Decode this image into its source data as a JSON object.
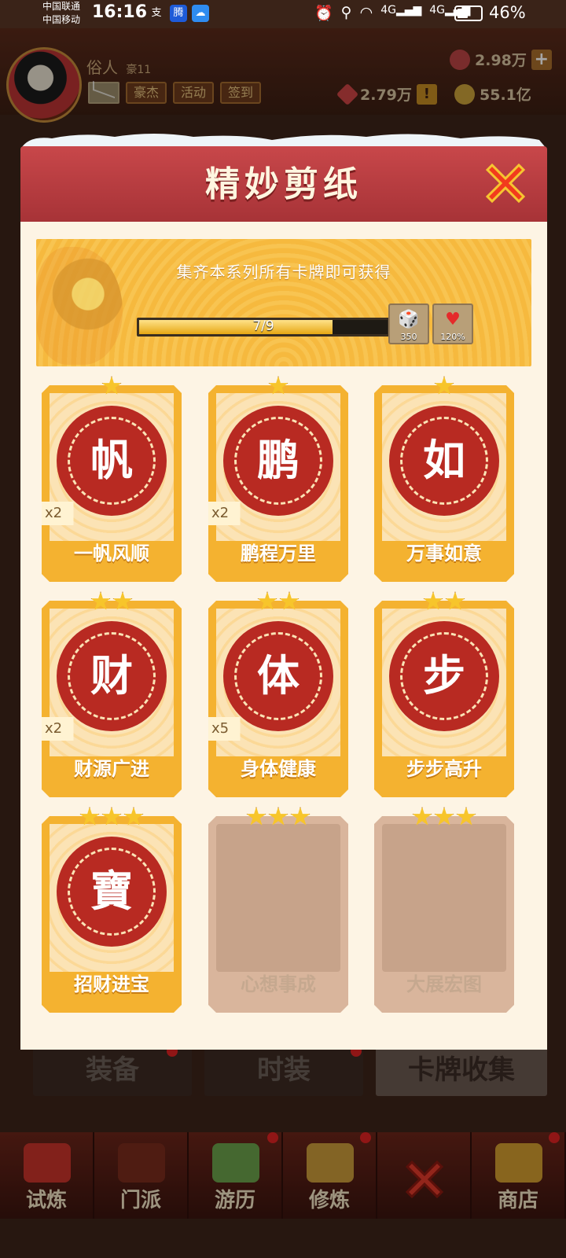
{
  "status_bar": {
    "carrier_1": "中国联通",
    "carrier_2": "中国移动",
    "time": "16:16",
    "battery_percent": "46%",
    "battery_level": 0.46
  },
  "player": {
    "name": "俗人",
    "rank": "豪11",
    "buttons": {
      "hero": "豪杰",
      "activity": "活动",
      "signin": "签到"
    }
  },
  "resources": {
    "gems": "2.98万",
    "diamonds": "2.79万",
    "coins": "55.1亿"
  },
  "modal": {
    "title": "精妙剪纸",
    "banner_text": "集齐本系列所有卡牌即可获得",
    "progress_text": "7/9",
    "progress_fraction": 0.778,
    "rewards": [
      {
        "icon": "dice-icon",
        "glyph": "🎲",
        "label": "350"
      },
      {
        "icon": "heart-icon",
        "glyph": "♥",
        "label": "120%"
      }
    ],
    "cards": [
      {
        "name": "一帆风顺",
        "stars": 1,
        "mult": "x2",
        "glyph": "帆",
        "locked": false
      },
      {
        "name": "鹏程万里",
        "stars": 1,
        "mult": "x2",
        "glyph": "鹏",
        "locked": false
      },
      {
        "name": "万事如意",
        "stars": 1,
        "mult": "",
        "glyph": "如",
        "locked": false
      },
      {
        "name": "财源广进",
        "stars": 2,
        "mult": "x2",
        "glyph": "财",
        "locked": false
      },
      {
        "name": "身体健康",
        "stars": 2,
        "mult": "x5",
        "glyph": "体",
        "locked": false
      },
      {
        "name": "步步高升",
        "stars": 2,
        "mult": "",
        "glyph": "步",
        "locked": false
      },
      {
        "name": "招财进宝",
        "stars": 3,
        "mult": "",
        "glyph": "寶",
        "locked": false
      },
      {
        "name": "心想事成",
        "stars": 3,
        "mult": "",
        "glyph": "",
        "locked": true
      },
      {
        "name": "大展宏图",
        "stars": 3,
        "mult": "",
        "glyph": "",
        "locked": true
      }
    ]
  },
  "tabs": [
    "装备",
    "时装",
    "卡牌收集"
  ],
  "bottom_nav": [
    "试炼",
    "门派",
    "游历",
    "修炼",
    "",
    "商店"
  ],
  "colors": {
    "header_red": "#b83a3d",
    "card_gold": "#f4b230",
    "cut_red": "#b82a22"
  }
}
